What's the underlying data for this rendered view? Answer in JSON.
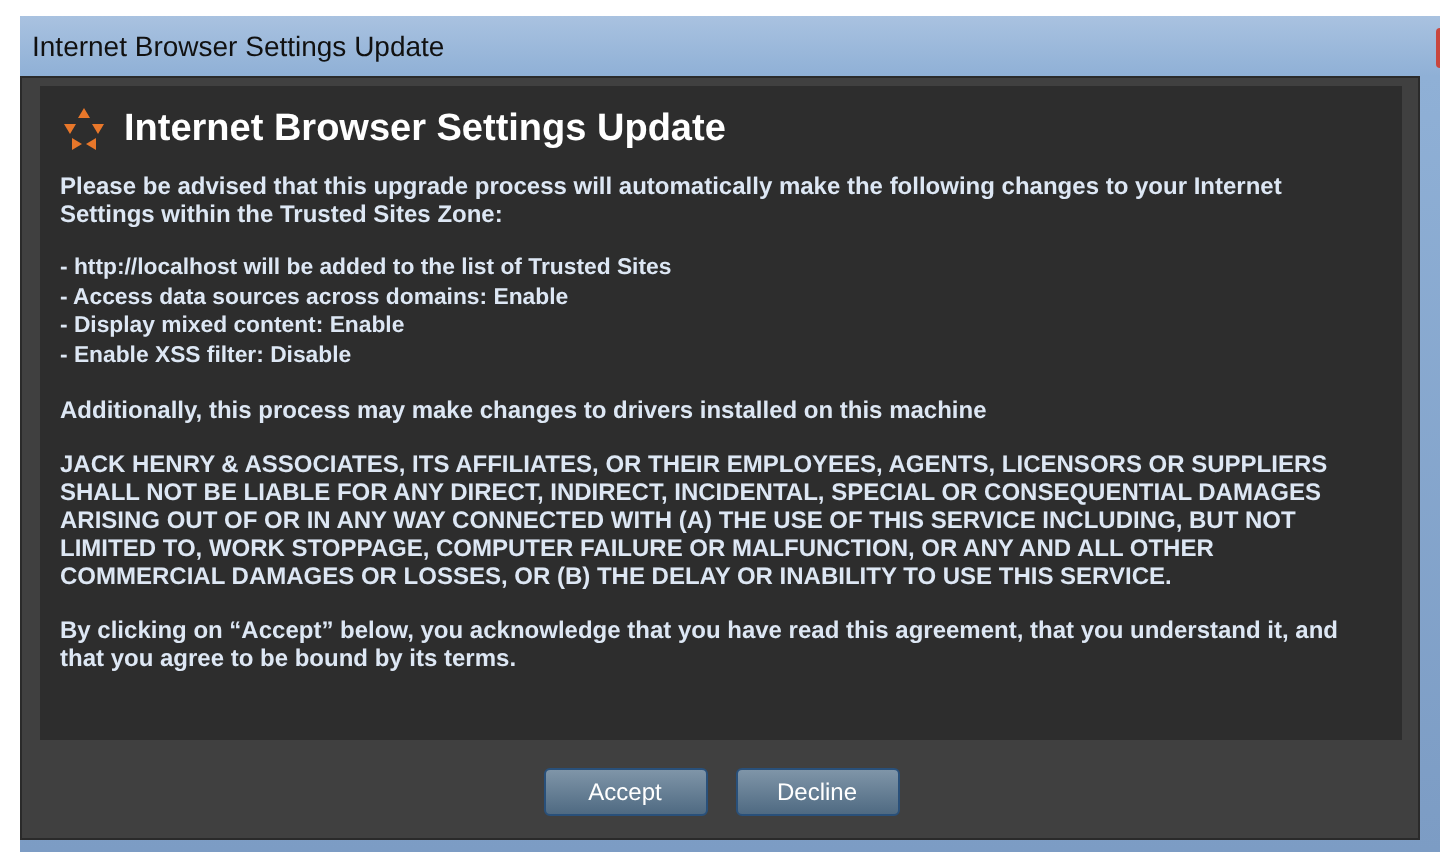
{
  "window": {
    "title": "Internet Browser Settings Update"
  },
  "dialog": {
    "heading": "Internet Browser Settings Update",
    "paragraphs": [
      {
        "kind": "text",
        "text": "Please be advised that this upgrade process will automatically make the following changes to your Internet Settings within the Trusted Sites Zone:"
      },
      {
        "kind": "list",
        "items": [
          "- http://localhost will be added to the list of Trusted Sites",
          "- Access data sources across domains: Enable",
          "- Display mixed content: Enable",
          "- Enable XSS filter: Disable"
        ]
      },
      {
        "kind": "text",
        "text": "Additionally, this process may make changes to drivers installed on this machine"
      },
      {
        "kind": "text",
        "text": "JACK HENRY & ASSOCIATES, ITS AFFILIATES, OR THEIR EMPLOYEES, AGENTS, LICENSORS OR SUPPLIERS SHALL NOT BE LIABLE FOR ANY DIRECT, INDIRECT, INCIDENTAL, SPECIAL OR CONSEQUENTIAL DAMAGES ARISING OUT OF OR IN ANY WAY CONNECTED WITH (A) THE USE OF THIS SERVICE INCLUDING, BUT NOT LIMITED TO, WORK STOPPAGE, COMPUTER FAILURE OR MALFUNCTION, OR ANY AND ALL OTHER COMMERCIAL DAMAGES OR LOSSES, OR (B) THE DELAY OR INABILITY TO USE THIS SERVICE."
      },
      {
        "kind": "text",
        "text": "By clicking on “Accept” below, you acknowledge that you have read this agreement, that you understand it, and that you agree to be bound by its terms."
      }
    ],
    "buttons": [
      "Accept",
      "Decline"
    ]
  }
}
